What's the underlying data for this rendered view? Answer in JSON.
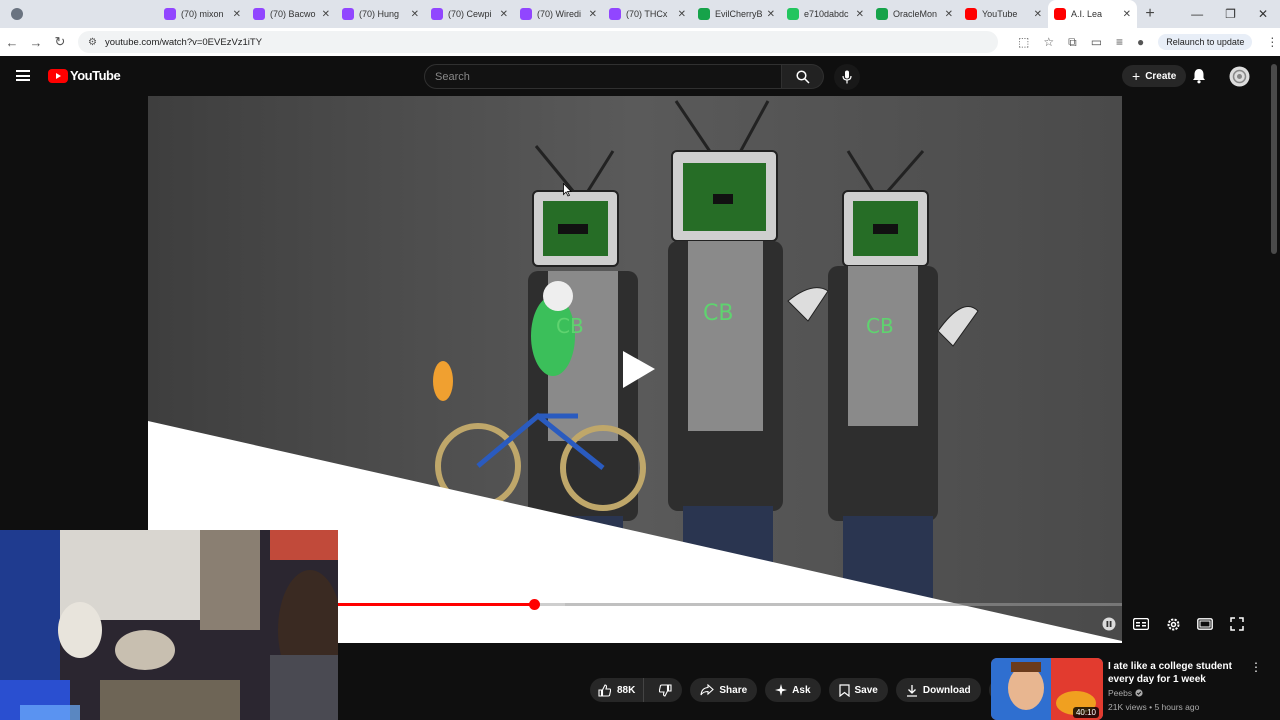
{
  "browser": {
    "tabs": [
      {
        "title": "",
        "color": "#6a7380"
      },
      {
        "title": "",
        "color": "#c7ccd6"
      },
      {
        "title": "",
        "color": "#9146ff"
      },
      {
        "title": "",
        "color": "#16a34a"
      },
      {
        "title": "",
        "color": "#ff0000"
      },
      {
        "title": "(70) mixon",
        "color": "#9146ff"
      },
      {
        "title": "(70) Bacwo",
        "color": "#9146ff"
      },
      {
        "title": "(70) Hung",
        "color": "#9146ff"
      },
      {
        "title": "(70) Cewpi",
        "color": "#9146ff"
      },
      {
        "title": "(70) Wiredi",
        "color": "#9146ff"
      },
      {
        "title": "(70) THCx",
        "color": "#9146ff"
      },
      {
        "title": "EvilCherryB",
        "color": "#16a34a"
      },
      {
        "title": "e710dabdc",
        "color": "#22c55e"
      },
      {
        "title": "OracleMon",
        "color": "#16a34a"
      },
      {
        "title": "YouTube",
        "color": "#ff0000"
      },
      {
        "title": "A.I. Lea",
        "color": "#ff0000",
        "active": true
      }
    ],
    "url": "youtube.com/watch?v=0EVEzVz1iTY",
    "relaunch_label": "Relaunch to update"
  },
  "youtube": {
    "logo_text": "YouTube",
    "search_placeholder": "Search",
    "create_label": "Create"
  },
  "player": {
    "progress_fraction": 0.25,
    "buffer_fraction": 0.29
  },
  "actions": {
    "like_count": "88K",
    "share_label": "Share",
    "ask_label": "Ask",
    "save_label": "Save",
    "download_label": "Download"
  },
  "suggestion": {
    "title": "I ate like a college student every day for 1 week",
    "channel": "Peebs",
    "meta": "21K views • 5 hours ago",
    "duration": "40:10"
  },
  "video_text": {
    "shirt_label": "CB"
  }
}
